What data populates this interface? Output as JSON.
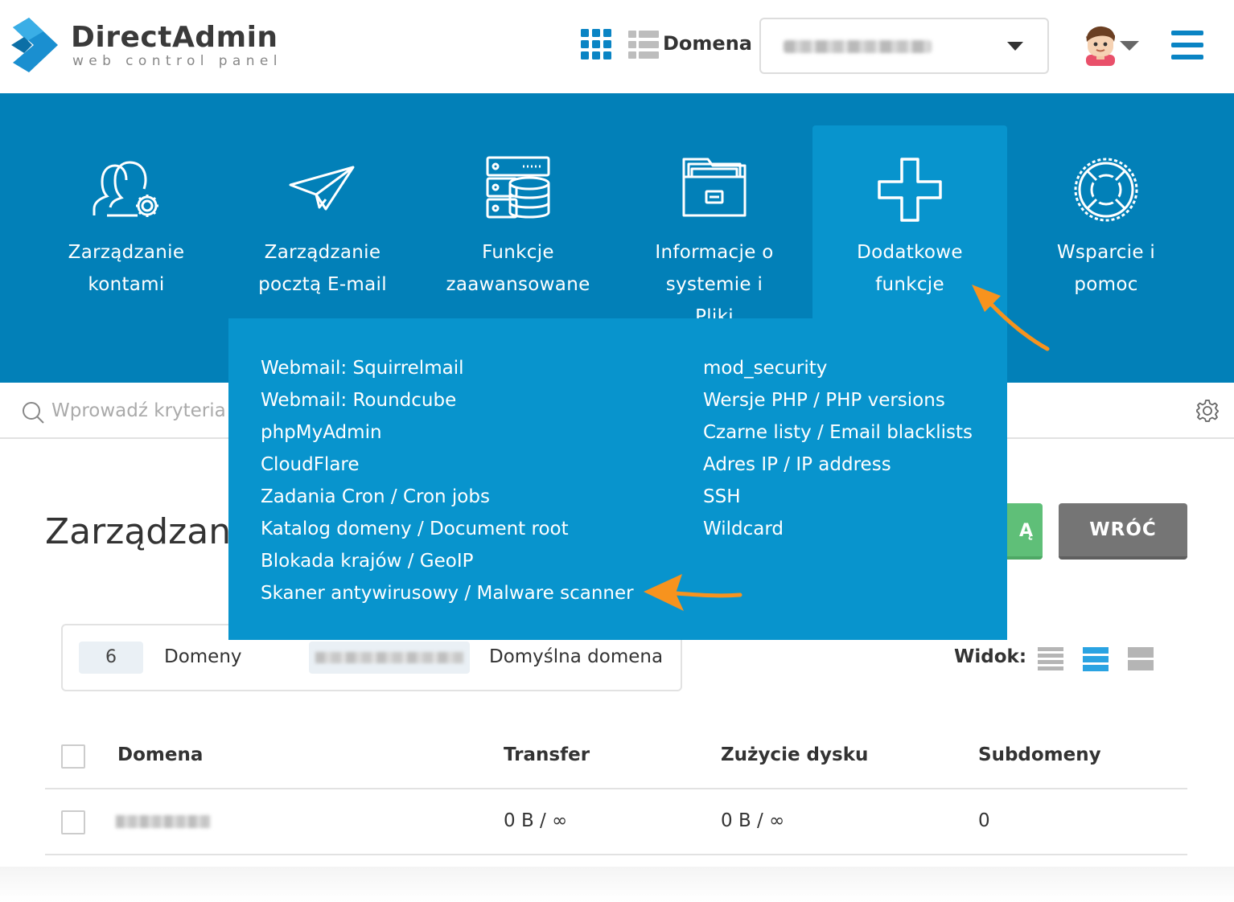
{
  "brand": {
    "title": "DirectAdmin",
    "subtitle": "web control panel"
  },
  "header": {
    "domain_label": "Domena",
    "domain_select_value": "",
    "icons": [
      "apps-grid-icon",
      "list-view-icon",
      "avatar",
      "hamburger-menu-icon"
    ]
  },
  "nav": {
    "items": [
      {
        "line1": "Zarządzanie",
        "line2": "kontami",
        "icon": "users-gear-icon"
      },
      {
        "line1": "Zarządzanie",
        "line2": "pocztą E-mail",
        "icon": "paper-plane-icon"
      },
      {
        "line1": "Funkcje",
        "line2": "zaawansowane",
        "icon": "server-database-icon"
      },
      {
        "line1": "Informacje o",
        "line2": "systemie i",
        "line3": "Pliki",
        "icon": "file-folder-icon"
      },
      {
        "line1": "Dodatkowe",
        "line2": "funkcje",
        "icon": "plus-icon"
      },
      {
        "line1": "Wsparcie i",
        "line2": "pomoc",
        "icon": "lifebuoy-icon"
      }
    ],
    "active_index": 4
  },
  "dropdown": {
    "left": [
      "Webmail: Squirrelmail",
      "Webmail: Roundcube",
      "phpMyAdmin",
      "CloudFlare",
      "Zadania Cron / Cron jobs",
      "Katalog domeny / Document root",
      "Blokada krajów / GeoIP",
      "Skaner antywirusowy / Malware scanner"
    ],
    "right": [
      "mod_security",
      "Wersje PHP / PHP versions",
      "Czarne listy / Email blacklists",
      "Adres IP / IP address",
      "SSH",
      "Wildcard"
    ]
  },
  "search": {
    "placeholder": "Wprowadź kryteria w"
  },
  "main": {
    "page_title": "Zarządzani",
    "green_button_label": "Ą",
    "back_button_label": "WRÓĆ",
    "stats": {
      "count": "6",
      "count_label": "Domeny",
      "default_domain_label": "Domyślna domena"
    },
    "view_label": "Widok:"
  },
  "table": {
    "columns": [
      "Domena",
      "Transfer",
      "Zużycie dysku",
      "Subdomeny"
    ],
    "rows": [
      {
        "domain": "",
        "transfer": "0 B / ∞",
        "disk": "0 B / ∞",
        "subdomains": "0"
      }
    ]
  },
  "colors": {
    "nav_bg": "#0280b8",
    "nav_active_bg": "#0894cd",
    "accent": "#0a84c4",
    "arrow": "#f7931e",
    "back_button": "#757575",
    "green_button": "#5fbf78"
  }
}
